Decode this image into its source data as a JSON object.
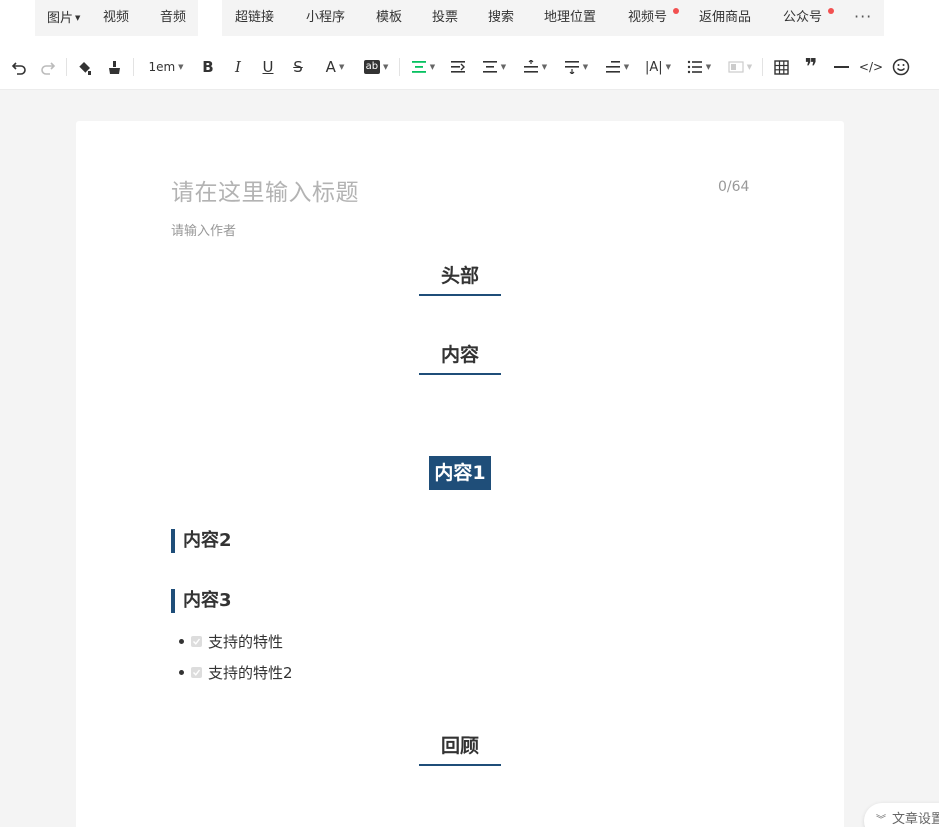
{
  "insert_bar": {
    "group1": [
      {
        "label": "图片",
        "dropdown": true
      },
      {
        "label": "视频"
      },
      {
        "label": "音频"
      }
    ],
    "group2": [
      {
        "label": "超链接"
      },
      {
        "label": "小程序"
      },
      {
        "label": "模板"
      },
      {
        "label": "投票"
      },
      {
        "label": "搜索"
      },
      {
        "label": "地理位置"
      },
      {
        "label": "视频号",
        "badge": true
      },
      {
        "label": "返佣商品"
      },
      {
        "label": "公众号",
        "badge": true
      }
    ],
    "more": "···"
  },
  "format_bar": {
    "font_size": "1em",
    "icons": [
      "undo-icon",
      "redo-icon",
      "format-painter-icon",
      "clear-format-icon",
      "font-size-dropdown",
      "bold-icon",
      "italic-icon",
      "underline-icon",
      "strikethrough-icon",
      "font-color-icon",
      "background-color-icon",
      "align-center-icon",
      "indent-icon",
      "line-height-icon",
      "paragraph-spacing-before-icon",
      "paragraph-spacing-after-icon",
      "text-indent-icon",
      "letter-spacing-icon",
      "list-icon",
      "image-caption-icon",
      "table-icon",
      "quote-icon",
      "divider-icon",
      "code-icon",
      "emoji-icon"
    ],
    "colors": {
      "accent": "#07c160",
      "badge": "#f25050"
    }
  },
  "editor": {
    "title_placeholder": "请在这里输入标题",
    "title_counter": "0/64",
    "author_placeholder": "请输入作者",
    "section1": "头部",
    "section2": "内容",
    "highlight": "内容1",
    "bar1": "内容2",
    "bar2": "内容3",
    "list": [
      "支持的特性",
      "支持的特性2"
    ],
    "section3": "回顾",
    "theme_color": "#1f4e79"
  },
  "settings_button": "文章设置"
}
